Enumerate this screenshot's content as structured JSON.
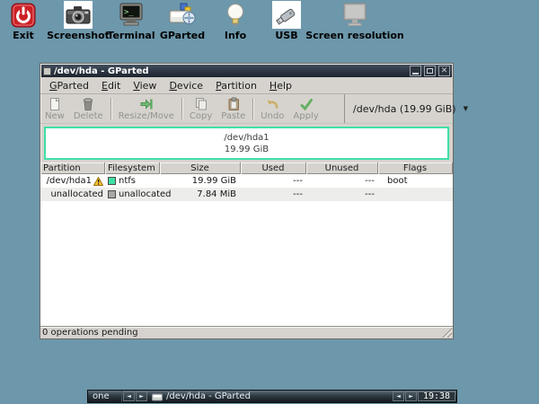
{
  "icons": {
    "close_glyph": "✕",
    "left_arrow_glyph": "◄",
    "right_arrow_glyph": "►",
    "dropdown_glyph": "▼"
  },
  "desktop": {
    "background_color": "#6d97aa",
    "icons": [
      {
        "label": "Exit"
      },
      {
        "label": "Screenshot"
      },
      {
        "label": "Terminal"
      },
      {
        "label": "GParted"
      },
      {
        "label": "Info"
      },
      {
        "label": "USB"
      },
      {
        "label": "Screen resolution"
      }
    ]
  },
  "window": {
    "title": "/dev/hda - GParted",
    "menu": {
      "items": [
        {
          "mnemonic": "G",
          "rest": "Parted"
        },
        {
          "mnemonic": "E",
          "rest": "dit"
        },
        {
          "mnemonic": "V",
          "rest": "iew"
        },
        {
          "mnemonic": "D",
          "rest": "evice"
        },
        {
          "mnemonic": "P",
          "rest": "artition"
        },
        {
          "mnemonic": "H",
          "rest": "elp"
        }
      ]
    },
    "toolbar": {
      "buttons": [
        {
          "label": "New"
        },
        {
          "label": "Delete"
        },
        {
          "label": "Resize/Move"
        },
        {
          "label": "Copy"
        },
        {
          "label": "Paste"
        },
        {
          "label": "Undo"
        },
        {
          "label": "Apply"
        }
      ],
      "device_selector": {
        "value": "/dev/hda (19.99 GiB)"
      }
    },
    "disk_visual": {
      "partition_label": "/dev/hda1",
      "partition_size": "19.99 GiB",
      "border_color": "#3fe0a6"
    },
    "table": {
      "columns": [
        "Partition",
        "Filesystem",
        "Size",
        "Used",
        "Unused",
        "Flags"
      ],
      "rows": [
        {
          "partition": "/dev/hda1",
          "has_warning": true,
          "filesystem": "ntfs",
          "fs_color": "#3fe0a6",
          "size": "19.99 GiB",
          "used": "---",
          "unused": "---",
          "flags": "boot"
        },
        {
          "partition": "unallocated",
          "has_warning": false,
          "filesystem": "unallocated",
          "fs_color": "#a8a8a8",
          "size": "7.84 MiB",
          "used": "---",
          "unused": "---",
          "flags": ""
        }
      ]
    },
    "statusbar": {
      "text": "0 operations pending"
    }
  },
  "taskbar": {
    "workspace": "one",
    "task": {
      "label": "/dev/hda - GParted"
    },
    "clock": "19:38"
  }
}
